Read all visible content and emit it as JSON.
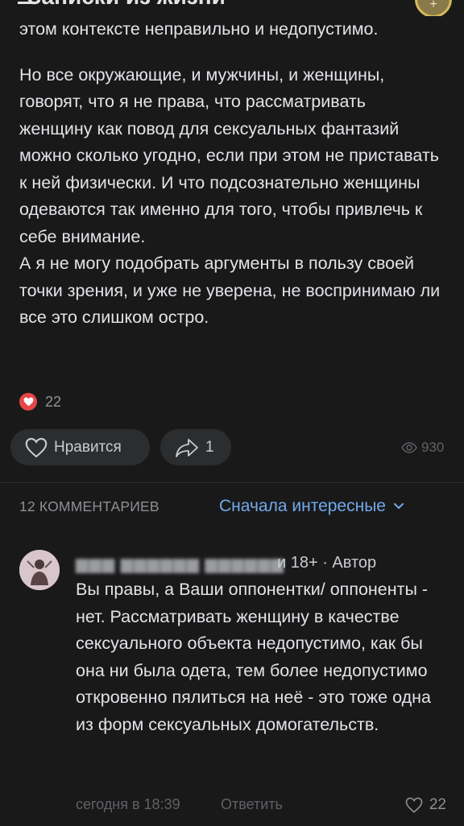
{
  "header": {
    "title": "Записки из жизни",
    "avatar_glyph": "+"
  },
  "post": {
    "paragraph1": "этом контексте неправильно и недопустимо.",
    "paragraph2": "Но все окружающие, и мужчины, и женщины, говорят, что я не права, что рассматривать женщину как повод для сексуальных фантазий можно сколько угодно, если при этом не приставать к ней физически. И что подсознательно женщины одеваются так именно для того, чтобы привлечь к себе внимание.",
    "paragraph3": "А я не могу подобрать аргументы в пользу своей точки зрения, и уже не уверена, не воспринимаю ли все это слишком остро.",
    "reactions_count": "22"
  },
  "actions": {
    "like_label": "Нравится",
    "share_count": "1",
    "views_count": "930"
  },
  "comments": {
    "header": "12 КОММЕНТАРИЕВ",
    "sort_label": "Сначала интересные",
    "items": [
      {
        "author_meta": "и 18+ · Автор",
        "text": "Вы правы, а Ваши оппонентки/ оппоненты - нет. Рассматривать женщину в качестве сексуального объекта недопустимо, как бы она ни была одета, тем более недопустимо откровенно пялиться на неё - это тоже одна из форм сексуальных домогательств.",
        "time": "сегодня в 18:39",
        "reply_label": "Ответить",
        "likes": "22"
      }
    ]
  },
  "colors": {
    "background": "#19191a",
    "text": "#e1e3e6",
    "accent": "#71aaeb",
    "heart": "#e64646"
  },
  "icons": [
    "heart-icon",
    "share-icon",
    "eye-icon",
    "chevron-down-icon"
  ]
}
